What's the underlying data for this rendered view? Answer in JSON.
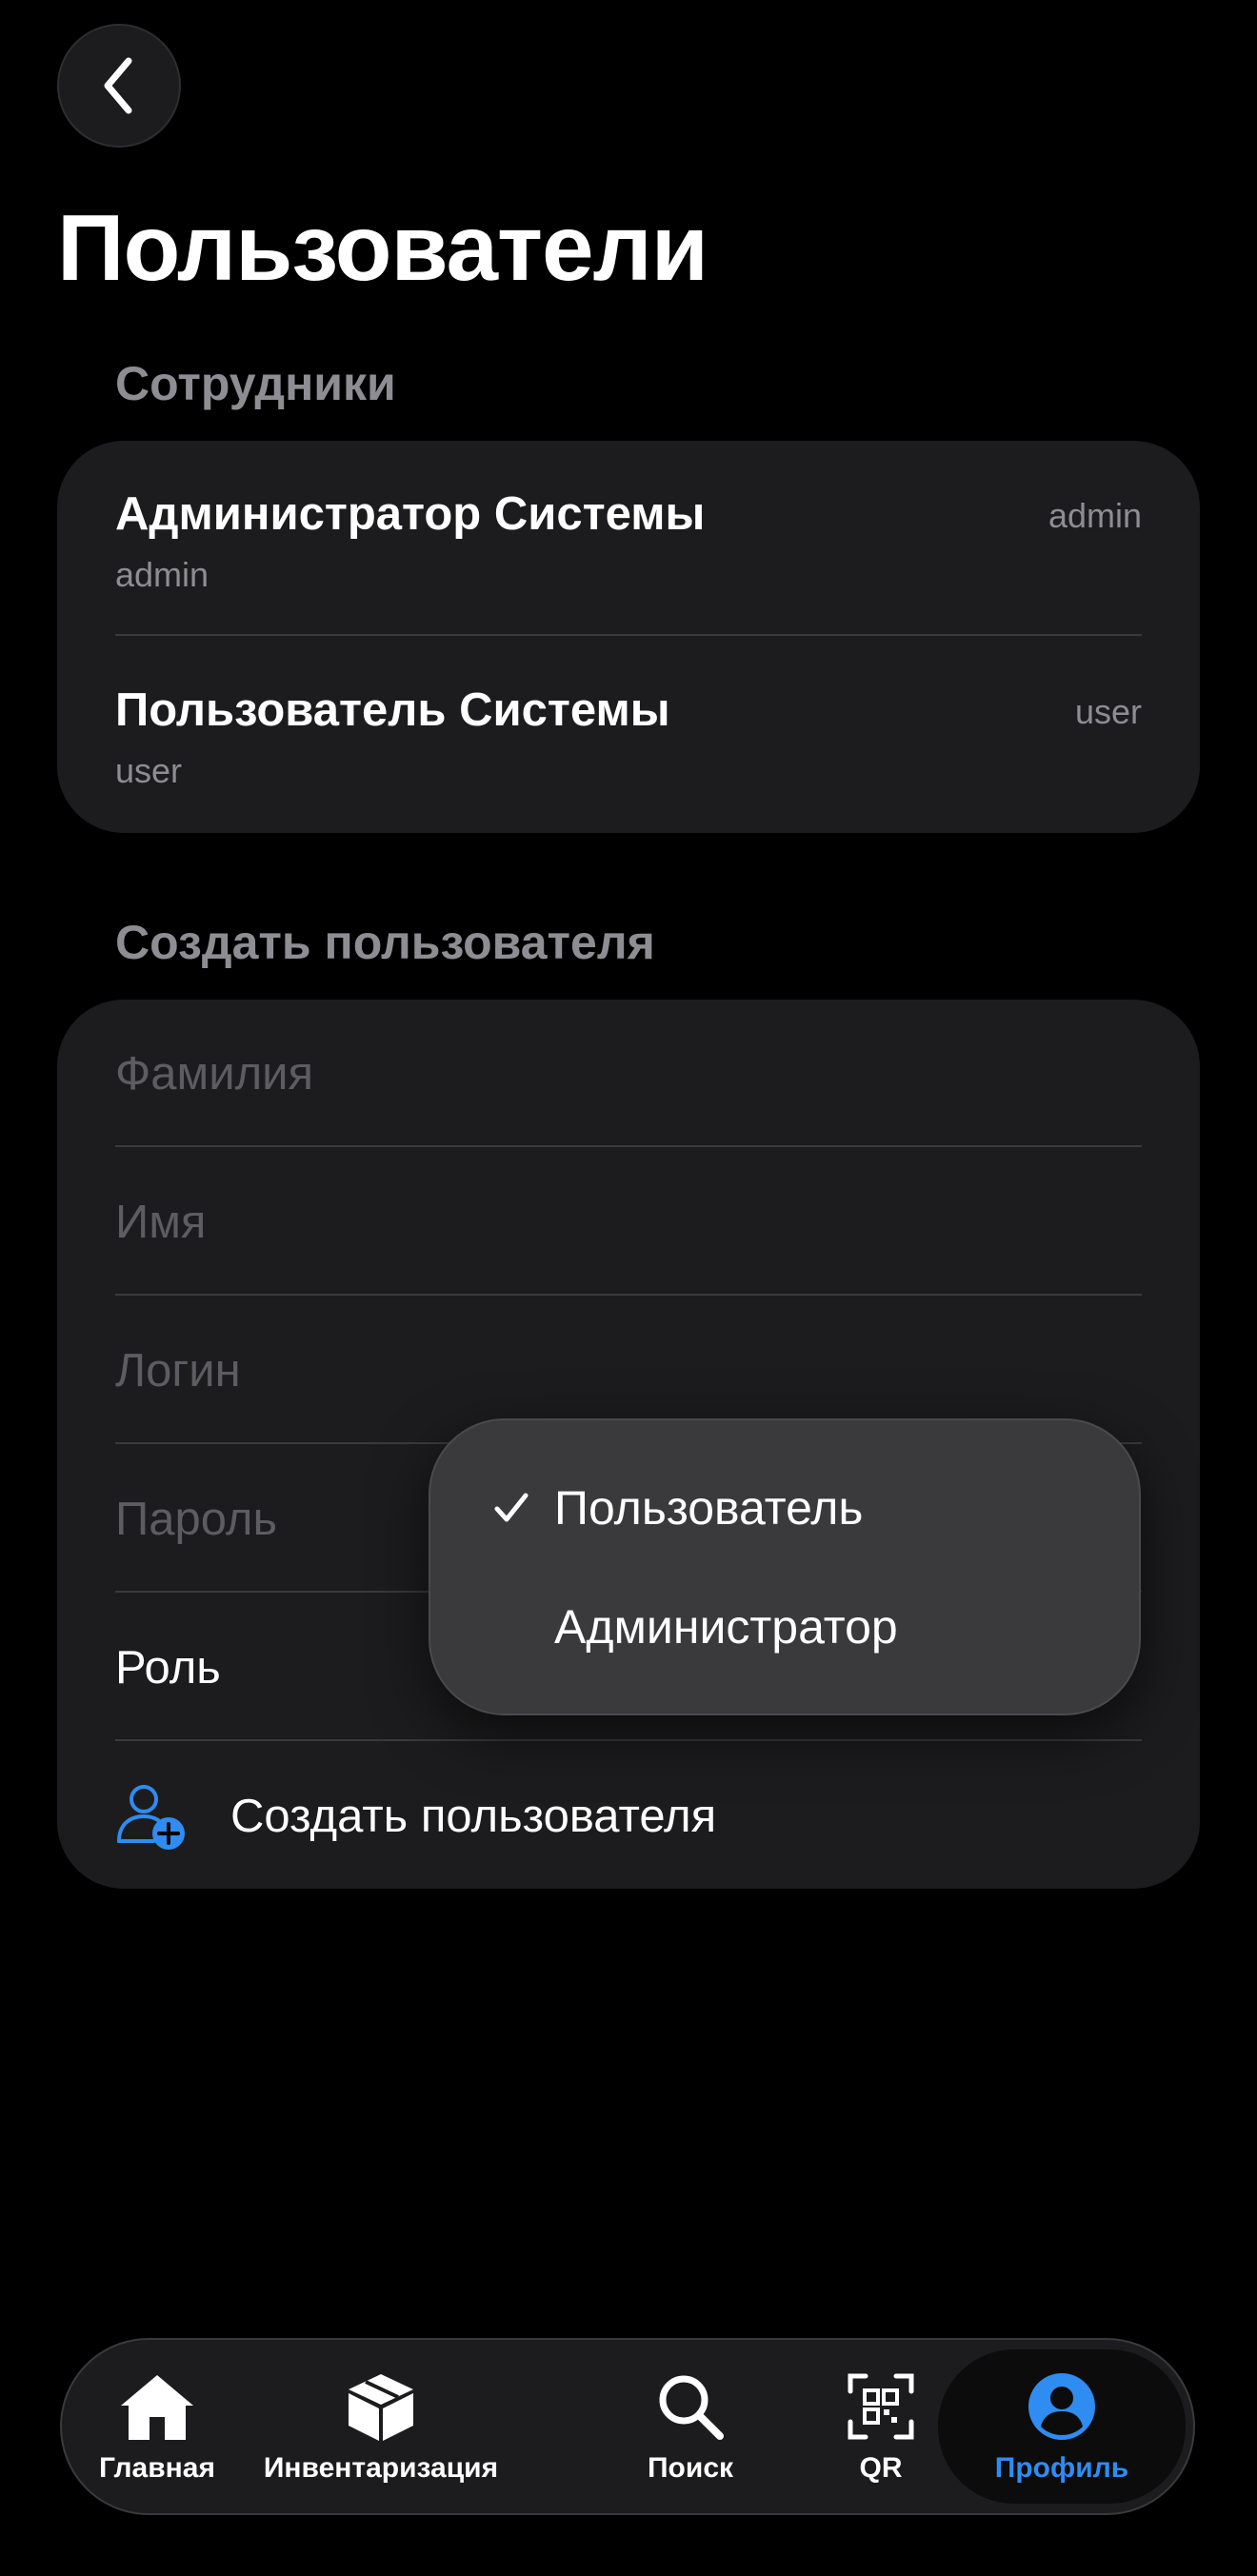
{
  "header": {
    "title": "Пользователи",
    "back_icon": "chevron-left-icon"
  },
  "employees": {
    "section_title": "Сотрудники",
    "items": [
      {
        "name": "Администратор Системы",
        "login": "admin",
        "role": "admin"
      },
      {
        "name": "Пользователь Системы",
        "login": "user",
        "role": "user"
      }
    ]
  },
  "create_form": {
    "section_title": "Создать пользователя",
    "last_name_placeholder": "Фамилия",
    "first_name_placeholder": "Имя",
    "login_placeholder": "Логин",
    "password_placeholder": "Пароль",
    "role_label": "Роль",
    "create_button_label": "Создать пользователя",
    "create_icon": "person-add-icon"
  },
  "role_menu": {
    "options": [
      "Пользователь",
      "Администратор"
    ],
    "selected": "Пользователь"
  },
  "tabbar": {
    "tabs": [
      {
        "label": "Главная",
        "icon": "house-icon"
      },
      {
        "label": "Инвентаризация",
        "icon": "box-icon"
      },
      {
        "label": "Поиск",
        "icon": "search-icon"
      },
      {
        "label": "QR",
        "icon": "qr-scan-icon"
      },
      {
        "label": "Профиль",
        "icon": "profile-icon"
      }
    ],
    "active": "Профиль"
  },
  "colors": {
    "accent": "#2F8CF0",
    "background": "#000000",
    "card": "#1C1C1E",
    "secondary_text": "#8D8D93"
  }
}
